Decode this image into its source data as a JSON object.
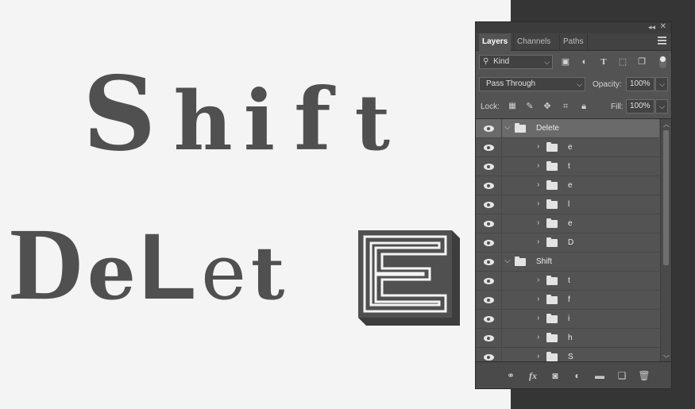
{
  "canvas": {
    "line1": [
      "S",
      "h",
      "i",
      "f",
      "t"
    ],
    "line2": [
      "D",
      "e",
      "L",
      "e",
      "t"
    ],
    "art_color": "#505050"
  },
  "panel": {
    "tabs": [
      "Layers",
      "Channels",
      "Paths"
    ],
    "active_tab": "Layers",
    "filter": {
      "label": "Kind",
      "icon": "search-icon"
    },
    "blend_mode": "Pass Through",
    "opacity_label": "Opacity:",
    "opacity_value": "100%",
    "lock_label": "Lock:",
    "fill_label": "Fill:",
    "fill_value": "100%",
    "layers": [
      {
        "name": "Delete",
        "type": "group",
        "expanded": true,
        "selected": true,
        "level": 0
      },
      {
        "name": "e",
        "type": "group",
        "expanded": false,
        "level": 1
      },
      {
        "name": "t",
        "type": "group",
        "expanded": false,
        "level": 1
      },
      {
        "name": "e",
        "type": "group",
        "expanded": false,
        "level": 1
      },
      {
        "name": "l",
        "type": "group",
        "expanded": false,
        "level": 1
      },
      {
        "name": "e",
        "type": "group",
        "expanded": false,
        "level": 1
      },
      {
        "name": "D",
        "type": "group",
        "expanded": false,
        "level": 1
      },
      {
        "name": "Shift",
        "type": "group",
        "expanded": true,
        "level": 0
      },
      {
        "name": "t",
        "type": "group",
        "expanded": false,
        "level": 1
      },
      {
        "name": "f",
        "type": "group",
        "expanded": false,
        "level": 1
      },
      {
        "name": "i",
        "type": "group",
        "expanded": false,
        "level": 1
      },
      {
        "name": "h",
        "type": "group",
        "expanded": false,
        "level": 1
      },
      {
        "name": "S",
        "type": "group",
        "expanded": false,
        "level": 1
      }
    ],
    "bottom_icons": [
      "link-icon",
      "fx-icon",
      "mask-icon",
      "adjustment-icon",
      "new-group-icon",
      "new-layer-icon",
      "trash-icon"
    ],
    "bottom_fx_label": "fx"
  }
}
